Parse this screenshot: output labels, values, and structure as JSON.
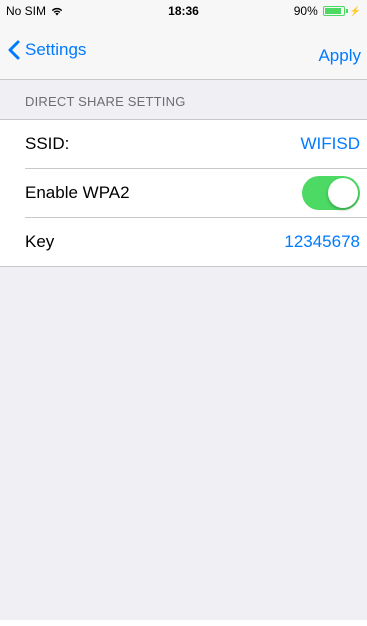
{
  "status_bar": {
    "carrier": "No SIM",
    "time": "18:36",
    "battery": "90%",
    "battery_level": 0.9
  },
  "nav": {
    "back_label": "Settings",
    "action_label": "Apply"
  },
  "section": {
    "header": "DIRECT SHARE SETTING"
  },
  "rows": [
    {
      "label": "SSID:",
      "value": "WIFISD"
    },
    {
      "label": "Enable WPA2",
      "toggle_on": true
    },
    {
      "label": "Key",
      "value": "12345678"
    }
  ],
  "colors": {
    "accent": "#007aff",
    "toggle_on": "#4cd964",
    "background": "#efeff4"
  }
}
